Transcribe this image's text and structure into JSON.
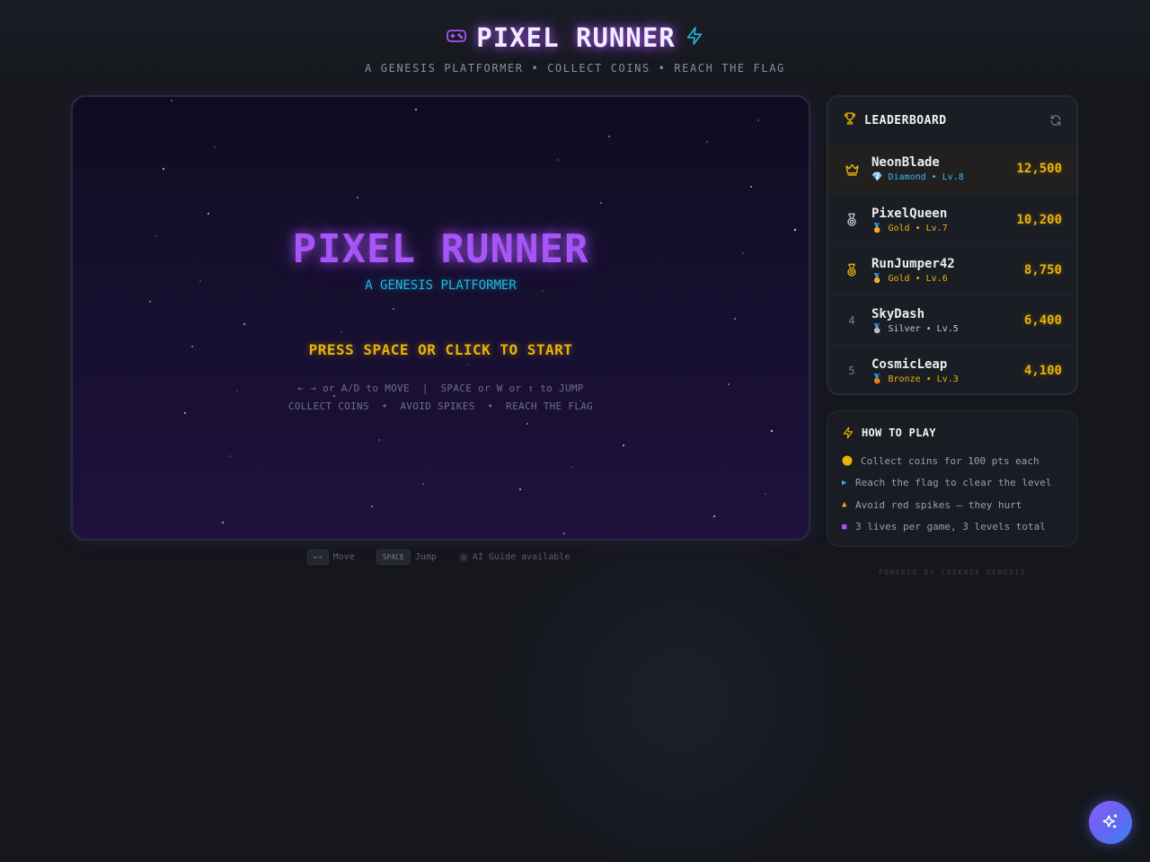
{
  "header": {
    "title": "PIXEL RUNNER",
    "subtitle": "A GENESIS PLATFORMER • COLLECT COINS • REACH THE FLAG",
    "icons": [
      "gamepad-icon",
      "lightning-icon"
    ]
  },
  "game": {
    "title": "PIXEL RUNNER",
    "subtitle": "A GENESIS PLATFORMER",
    "start_prompt": "PRESS SPACE OR CLICK TO START",
    "controls_hint": "← → or A/D to MOVE  |  SPACE or W or ↑ to JUMP",
    "objectives_hint": "COLLECT COINS  •  AVOID SPIKES  •  REACH THE FLAG"
  },
  "controls_bar": {
    "move_key": "←→",
    "move_label": "Move",
    "jump_key": "SPACE",
    "jump_label": "Jump",
    "ai_label": "AI Guide available"
  },
  "leaderboard": {
    "title": "LEADERBOARD",
    "entries": [
      {
        "rank": "1",
        "rank_icon": "crown-icon",
        "name": "NeonBlade",
        "tier_icon": "💎",
        "tier": "Diamond • Lv.8",
        "tier_color": "#38bdf8",
        "score": "12,500"
      },
      {
        "rank": "2",
        "rank_icon": "medal-icon",
        "name": "PixelQueen",
        "tier_icon": "🏅",
        "tier": "Gold • Lv.7",
        "tier_color": "#eab308",
        "score": "10,200"
      },
      {
        "rank": "3",
        "rank_icon": "medal-icon",
        "name": "RunJumper42",
        "tier_icon": "🏅",
        "tier": "Gold • Lv.6",
        "tier_color": "#eab308",
        "score": "8,750"
      },
      {
        "rank": "4",
        "rank_icon": "",
        "name": "SkyDash",
        "tier_icon": "🥈",
        "tier": "Silver • Lv.5",
        "tier_color": "#c4c8d4",
        "score": "6,400"
      },
      {
        "rank": "5",
        "rank_icon": "",
        "name": "CosmicLeap",
        "tier_icon": "🥉",
        "tier": "Bronze • Lv.3",
        "tier_color": "#eab308",
        "score": "4,100"
      }
    ]
  },
  "how_to_play": {
    "title": "HOW TO PLAY",
    "items": [
      {
        "bullet": "●",
        "color": "#eab308",
        "text": "Collect coins for 100 pts each"
      },
      {
        "bullet": "▶",
        "color": "#22b8e0",
        "text": "Reach the flag to clear the level"
      },
      {
        "bullet": "▲",
        "color": "#eab308",
        "text": "Avoid red spikes — they hurt"
      },
      {
        "bullet": "■",
        "color": "#a855f7",
        "text": "3 lives per game, 3 levels total"
      }
    ]
  },
  "footer": {
    "powered_by": "POWERED BY TASKADE GENESIS"
  },
  "colors": {
    "accent_purple": "#a855f7",
    "accent_cyan": "#22b8e0",
    "accent_gold": "#eab308",
    "background": "#15171d"
  }
}
